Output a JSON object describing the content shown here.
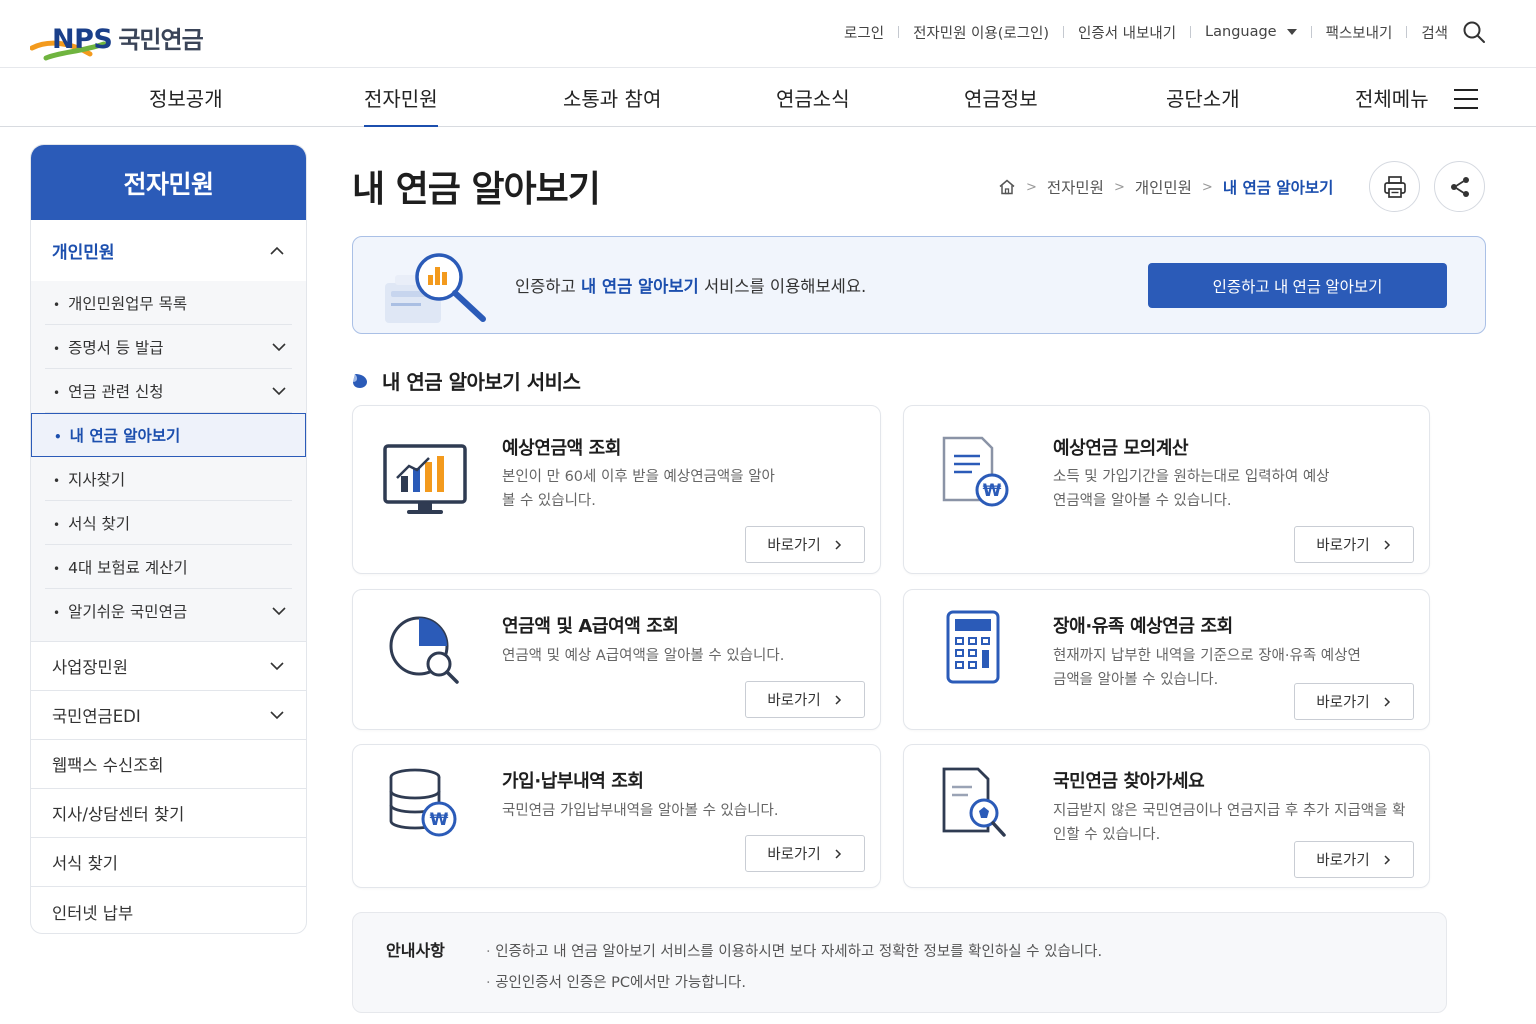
{
  "brand": {
    "logo_en": "NPS",
    "logo_ko": "국민연금",
    "colors": {
      "primary": "#2b5bb8",
      "link": "#1c4fae",
      "accent_orange": "#f39a1d",
      "accent_green": "#6fb43f"
    }
  },
  "util_nav": {
    "login": "로그인",
    "civil_login": "전자민원 이용(로그인)",
    "cert_export": "인증서 내보내기",
    "language": "Language",
    "fax": "팩스보내기",
    "search": "검색"
  },
  "gnb": [
    {
      "label": "정보공개"
    },
    {
      "label": "전자민원"
    },
    {
      "label": "소통과 참여"
    },
    {
      "label": "연금소식"
    },
    {
      "label": "연금정보"
    },
    {
      "label": "공단소개"
    },
    {
      "label": "전체메뉴"
    }
  ],
  "sidebar": {
    "title": "전자민원",
    "section_title": "개인민원",
    "sub_items": [
      {
        "label": "개인민원업무 목록"
      },
      {
        "label": "증명서 등 발급"
      },
      {
        "label": "연금 관련 신청"
      },
      {
        "label": "내 연금 알아보기"
      },
      {
        "label": "지사찾기"
      },
      {
        "label": "서식 찾기"
      },
      {
        "label": "4대 보험료 계산기"
      },
      {
        "label": "알기쉬운 국민연금"
      }
    ],
    "rows": [
      {
        "label": "사업장민원"
      },
      {
        "label": "국민연금EDI"
      },
      {
        "label": "웹팩스 수신조회"
      },
      {
        "label": "지사/상담센터 찾기"
      },
      {
        "label": "서식 찾기"
      },
      {
        "label": "인터넷 납부"
      }
    ]
  },
  "page": {
    "title": "내 연금 알아보기",
    "breadcrumb": [
      "전자민원",
      "개인민원",
      "내 연금 알아보기"
    ]
  },
  "auth": {
    "text_before": "인증하고 ",
    "text_highlight": "내 연금 알아보기",
    "text_after": " 서비스를 이용해보세요.",
    "button": "인증하고 내 연금 알아보기"
  },
  "services": {
    "title": "내 연금 알아보기 서비스",
    "go_label": "바로가기",
    "cards": [
      {
        "title": "예상연금액 조회",
        "desc": "본인이 만 60세 이후 받을 예상연금액을 알아볼 수 있습니다.",
        "icon": "monitor-chart-icon"
      },
      {
        "title": "예상연금 모의계산",
        "desc": "소득 및 가입기간을 원하는대로 입력하여 예상연금액을 알아볼 수 있습니다.",
        "icon": "document-won-icon"
      },
      {
        "title": "연금액 및 A급여액 조회",
        "desc": "연금액 및 예상 A급여액을 알아볼 수 있습니다.",
        "icon": "pie-search-icon"
      },
      {
        "title": "장애·유족 예상연금 조회",
        "desc": "현재까지 납부한 내역을 기준으로 장애·유족 예상연금액을 알아볼 수 있습니다.",
        "icon": "calculator-icon"
      },
      {
        "title": "가입·납부내역 조회",
        "desc": "국민연금 가입납부내역을 알아볼 수 있습니다.",
        "icon": "database-won-icon"
      },
      {
        "title": "국민연금 찾아가세요",
        "desc": "지급받지 않은 국민연금이나 연금지급 후 추가 지급액을 확인할 수 있습니다.",
        "icon": "document-search-icon"
      }
    ]
  },
  "notice": {
    "title": "안내사항",
    "items": [
      "인증하고 내 연금 알아보기 서비스를 이용하시면 보다 자세하고 정확한 정보를 확인하실 수 있습니다.",
      "공인인증서 인증은 PC에서만 가능합니다."
    ]
  }
}
